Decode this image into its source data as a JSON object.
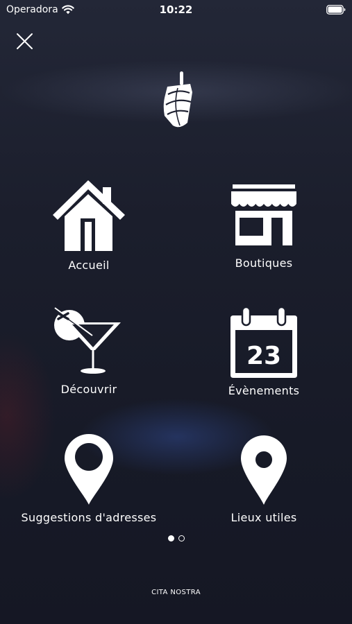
{
  "status_bar": {
    "carrier": "Operadora",
    "time": "10:22",
    "wifi_icon": "wifi-icon",
    "battery_icon": "battery-icon"
  },
  "header": {
    "close_icon": "close-icon",
    "logo": "brand-logo"
  },
  "menu": {
    "items": [
      {
        "label": "Accueil",
        "icon": "house-icon"
      },
      {
        "label": "Boutiques",
        "icon": "storefront-icon"
      },
      {
        "label": "Découvrir",
        "icon": "cocktail-icon"
      },
      {
        "label": "Évènements",
        "icon": "calendar-icon",
        "calendar_day": "23"
      },
      {
        "label": "Suggestions d'adresses",
        "icon": "map-pin-icon"
      },
      {
        "label": "Lieux utiles",
        "icon": "map-pin-icon"
      }
    ]
  },
  "pagination": {
    "total_pages": 2,
    "active_page": 1
  },
  "footer": {
    "brand": "CITA NOSTRA"
  },
  "colors": {
    "background": "#181a26",
    "foreground": "#ffffff",
    "accent_glow": "#30488c"
  }
}
